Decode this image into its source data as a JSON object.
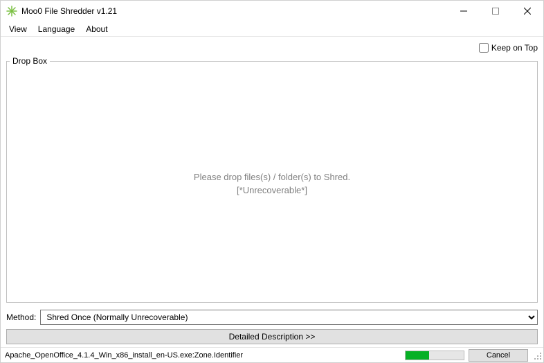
{
  "window": {
    "title": "Moo0 File Shredder v1.21"
  },
  "menu": {
    "view": "View",
    "language": "Language",
    "about": "About"
  },
  "keep_on_top": {
    "label": "Keep on Top",
    "checked": false
  },
  "dropbox": {
    "legend": "Drop Box",
    "line1": "Please drop files(s) / folder(s) to Shred.",
    "line2": "[*Unrecoverable*]"
  },
  "method": {
    "label": "Method:",
    "selected": "Shred Once (Normally Unrecoverable)"
  },
  "detail_button": "Detailed Description >>",
  "status": {
    "text": "Apache_OpenOffice_4.1.4_Win_x86_install_en-US.exe:Zone.Identifier",
    "progress_percent": 40,
    "cancel": "Cancel"
  },
  "colors": {
    "progress_fill": "#06b025"
  }
}
